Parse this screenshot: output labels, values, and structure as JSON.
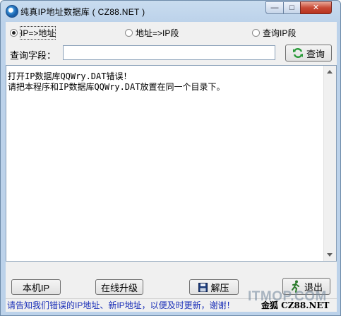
{
  "window": {
    "title": "纯真IP地址数据库 ( CZ88.NET )"
  },
  "titlebar_buttons": {
    "minimize": "—",
    "maximize": "□",
    "close": "✕"
  },
  "mode_options": [
    {
      "label": "IP=>地址",
      "checked": true
    },
    {
      "label": "地址=>IP段",
      "checked": false
    },
    {
      "label": "查询IP段",
      "checked": false
    }
  ],
  "query": {
    "label": "查询字段：",
    "value": "",
    "button_label": "查询"
  },
  "output": {
    "text": "打开IP数据库QQWry.DAT错误！\n请把本程序和IP数据库QQWry.DAT放置在同一个目录下。"
  },
  "buttons": {
    "local_ip": "本机IP",
    "online_upgrade": "在线升级",
    "extract": "解压",
    "exit": "退出"
  },
  "status": {
    "message": "请告知我们错误的IP地址、新IP地址，以便及时更新，谢谢！",
    "credit": "金狐  CZ88.NET"
  },
  "watermark": "ITMOP.COM",
  "colors": {
    "accent": "#1a2fb8",
    "close_button": "#c84a36",
    "refresh_icon": "#2a9a3a"
  },
  "icons": {
    "app": "app-globe-icon",
    "refresh": "refresh-icon",
    "floppy": "floppy-disk-icon",
    "exit": "running-man-icon"
  }
}
